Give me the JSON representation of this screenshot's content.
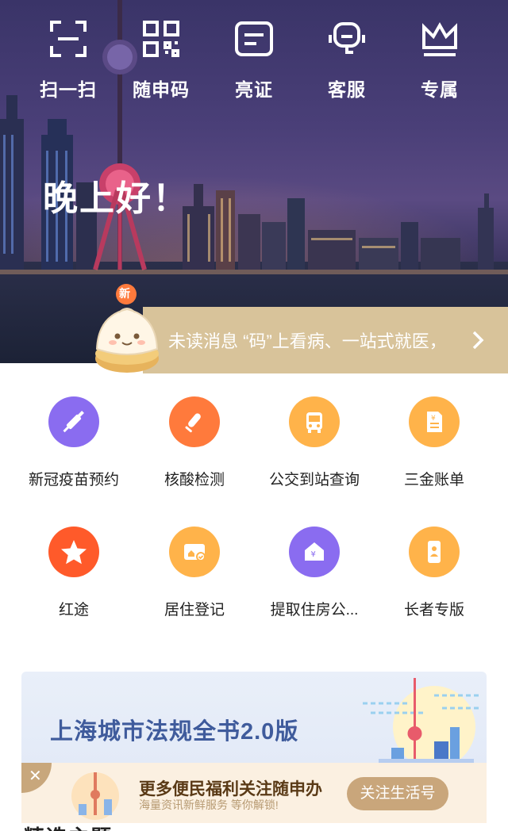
{
  "header": {
    "quick_actions": [
      {
        "label": "扫一扫",
        "icon": "scan-icon"
      },
      {
        "label": "随申码",
        "icon": "qr-code-icon"
      },
      {
        "label": "亮证",
        "icon": "id-card-icon"
      },
      {
        "label": "客服",
        "icon": "headset-icon"
      },
      {
        "label": "专属",
        "icon": "crown-icon"
      }
    ],
    "greeting": "晚上好！"
  },
  "notice": {
    "badge": "新",
    "text": "未读消息 “码”上看病、一站式就医，",
    "arrow_icon": "chevron-right-icon"
  },
  "services": [
    {
      "label": "新冠疫苗预约",
      "icon": "vaccine-syringe-icon",
      "color": "#8a6cf0"
    },
    {
      "label": "核酸检测",
      "icon": "test-swab-icon",
      "color": "#ff7a3c"
    },
    {
      "label": "公交到站查询",
      "icon": "bus-icon",
      "color": "#ffb34a"
    },
    {
      "label": "三金账单",
      "icon": "bill-document-icon",
      "color": "#ffb34a"
    },
    {
      "label": "红途",
      "icon": "red-star-icon",
      "color": "#ff5a2a"
    },
    {
      "label": "居住登记",
      "icon": "residence-card-icon",
      "color": "#ffb34a"
    },
    {
      "label": "提取住房公...",
      "icon": "housing-fund-icon",
      "color": "#8a6cf0"
    },
    {
      "label": "长者专版",
      "icon": "elder-phone-icon",
      "color": "#ffb34a"
    }
  ],
  "banner": {
    "title": "上海城市法规全书2.0版"
  },
  "follow_bar": {
    "close_icon": "close-icon",
    "headline": "更多便民福利关注随申办",
    "subline": "海量资讯新鲜服务 等你解锁!",
    "button": "关注生活号"
  },
  "section_peek": "精选主题"
}
